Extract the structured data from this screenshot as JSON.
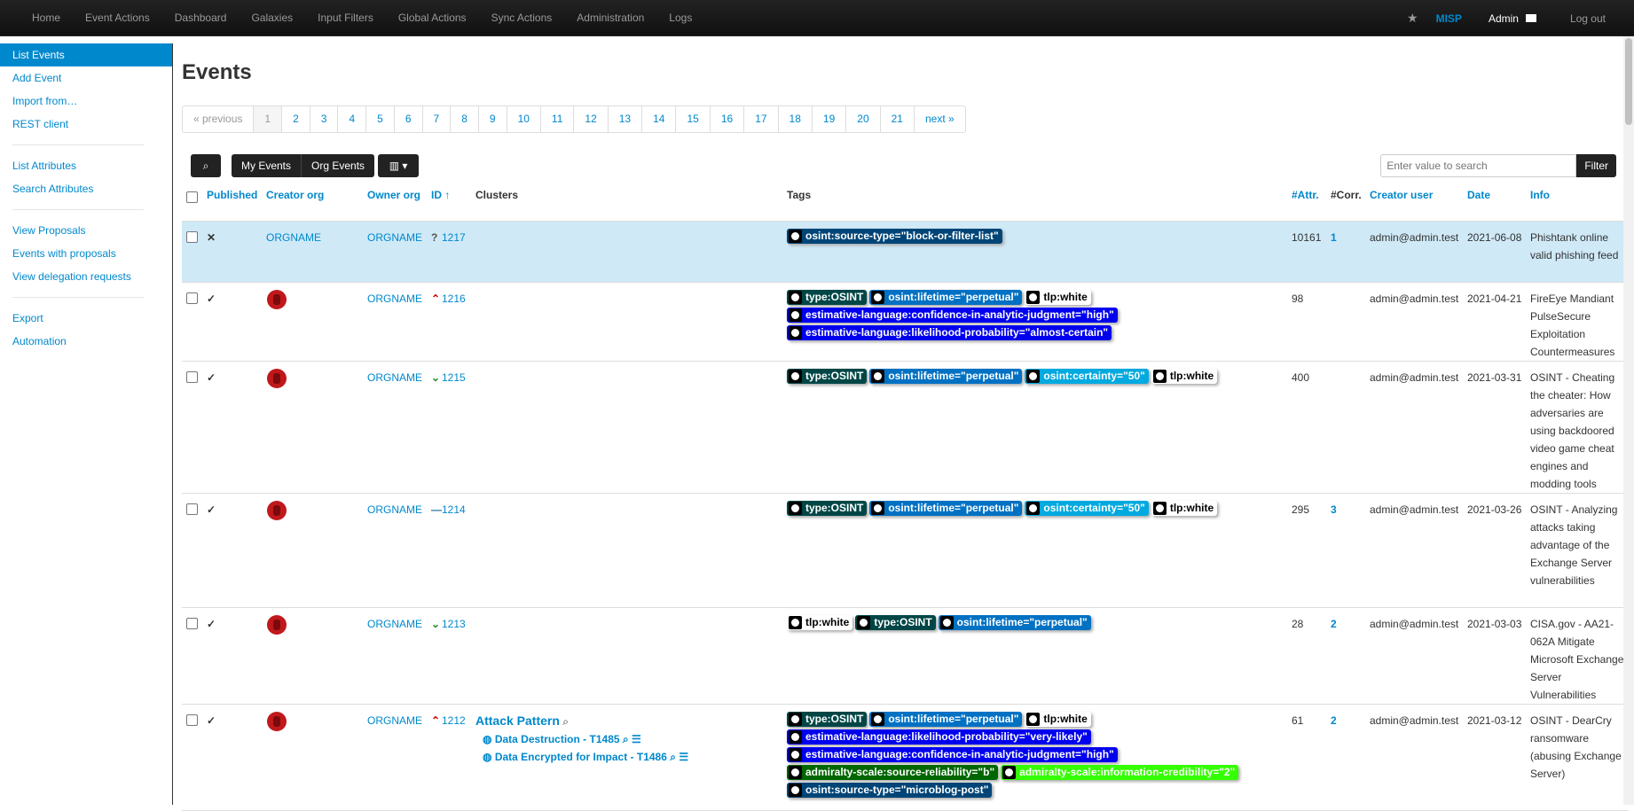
{
  "nav": {
    "items": [
      "Home",
      "Event Actions",
      "Dashboard",
      "Galaxies",
      "Input Filters",
      "Global Actions",
      "Sync Actions",
      "Administration",
      "Logs"
    ],
    "brand": "MISP",
    "user": "Admin",
    "logout": "Log out"
  },
  "sidebar": {
    "group1": [
      "List Events",
      "Add Event",
      "Import from…",
      "REST client"
    ],
    "group2": [
      "List Attributes",
      "Search Attributes"
    ],
    "group3": [
      "View Proposals",
      "Events with proposals",
      "View delegation requests"
    ],
    "group4": [
      "Export",
      "Automation"
    ]
  },
  "page": {
    "title": "Events"
  },
  "pagination": {
    "prev": "« previous",
    "pages": [
      "1",
      "2",
      "3",
      "4",
      "5",
      "6",
      "7",
      "8",
      "9",
      "10",
      "11",
      "12",
      "13",
      "14",
      "15",
      "16",
      "17",
      "18",
      "19",
      "20",
      "21"
    ],
    "next": "next »"
  },
  "toolbar": {
    "my_events": "My Events",
    "org_events": "Org Events",
    "filter": "Filter",
    "search_placeholder": "Enter value to search"
  },
  "table": {
    "headers": {
      "published": "Published",
      "creator_org": "Creator org",
      "owner_org": "Owner org",
      "id": "ID ↑",
      "clusters": "Clusters",
      "tags": "Tags",
      "attr": "#Attr.",
      "corr": "#Corr.",
      "creator_user": "Creator user",
      "date": "Date",
      "info": "Info"
    },
    "rows": [
      {
        "published": "✕",
        "creator_org": "ORGNAME",
        "owner_org": "ORGNAME",
        "priority": "?",
        "id": "1217",
        "attr": "10161",
        "corr": "1",
        "creator": "admin@admin.test",
        "date": "2021-06-08",
        "info": "Phishtank online valid phishing feed"
      },
      {
        "published": "✓",
        "owner_org": "ORGNAME",
        "priority": "⌃",
        "id": "1216",
        "attr": "98",
        "corr": "",
        "creator": "admin@admin.test",
        "date": "2021-04-21",
        "info": "FireEye Mandiant PulseSecure Exploitation Countermeasures"
      },
      {
        "published": "✓",
        "owner_org": "ORGNAME",
        "priority": "⌄",
        "id": "1215",
        "attr": "400",
        "corr": "",
        "creator": "admin@admin.test",
        "date": "2021-03-31",
        "info": "OSINT - Cheating the cheater: How adversaries are using backdoored video game cheat engines and modding tools"
      },
      {
        "published": "✓",
        "owner_org": "ORGNAME",
        "priority": "—",
        "id": "1214",
        "attr": "295",
        "corr": "3",
        "creator": "admin@admin.test",
        "date": "2021-03-26",
        "info": "OSINT - Analyzing attacks taking advantage of the Exchange Server vulnerabilities"
      },
      {
        "published": "✓",
        "owner_org": "ORGNAME",
        "priority": "⌄",
        "id": "1213",
        "attr": "28",
        "corr": "2",
        "creator": "admin@admin.test",
        "date": "2021-03-03",
        "info": "CISA.gov - AA21-062A Mitigate Microsoft Exchange Server Vulnerabilities"
      },
      {
        "published": "✓",
        "owner_org": "ORGNAME",
        "priority": "⌃",
        "id": "1212",
        "attr": "61",
        "corr": "2",
        "creator": "admin@admin.test",
        "date": "2021-03-12",
        "info": "OSINT - DearCry ransomware (abusing Exchange Server)"
      }
    ],
    "tags": {
      "src_block": "osint:source-type=\"block-or-filter-list\"",
      "osint": "type:OSINT",
      "lifetime": "osint:lifetime=\"perpetual\"",
      "white": "tlp:white",
      "confidence_high": "estimative-language:confidence-in-analytic-judgment=\"high\"",
      "likelihood_certain": "estimative-language:likelihood-probability=\"almost-certain\"",
      "certainty_50": "osint:certainty=\"50\"",
      "likelihood_likely": "estimative-language:likelihood-probability=\"very-likely\"",
      "reliability_b": "admiralty-scale:source-reliability=\"b\"",
      "credibility_2": "admiralty-scale:information-credibility=\"2\"",
      "src_micro": "osint:source-type=\"microblog-post\""
    },
    "cluster": {
      "title": "Attack Pattern",
      "items": [
        "Data Destruction - T1485",
        "Data Encrypted for Impact - T1486"
      ]
    }
  },
  "colors": {
    "accent": "#0088cc",
    "topbar": "#1b1b1b",
    "selected_row": "#cfe9f7"
  }
}
